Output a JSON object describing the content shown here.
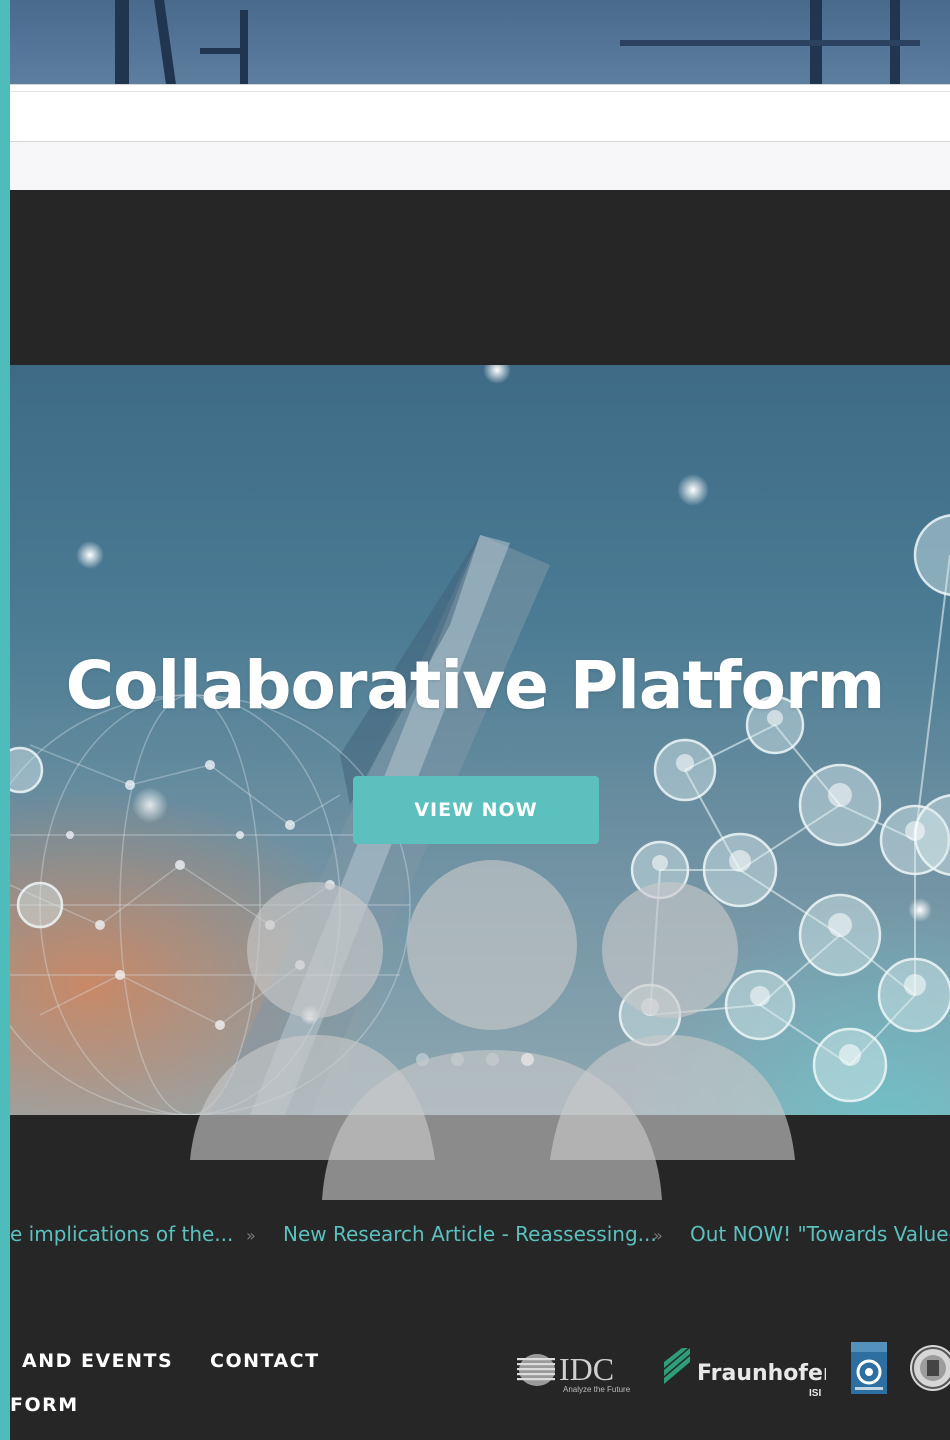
{
  "hero": {
    "title": "Collaborative Platform",
    "cta_label": "VIEW NOW",
    "slides_total": 4,
    "active_slide": 4
  },
  "ticker": {
    "items": [
      "e implications of the...",
      "New Research Article - Reassessing...",
      "Out NOW! \"Towards Value-C"
    ],
    "separator": "»"
  },
  "footer": {
    "nav": [
      "AND EVENTS",
      "CONTACT",
      "FORM"
    ],
    "logos": {
      "idc": {
        "name": "IDC",
        "tagline": "Analyze the Future"
      },
      "fraunhofer": {
        "name": "Fraunhofer",
        "sub": "ISI"
      },
      "leiden": {
        "name": "LAW LEIDEN"
      },
      "seal": {
        "name": "university-seal"
      }
    }
  },
  "colors": {
    "accent": "#5bc0be",
    "dark_bg": "#262626",
    "left_edge": "#4fbcbc"
  }
}
